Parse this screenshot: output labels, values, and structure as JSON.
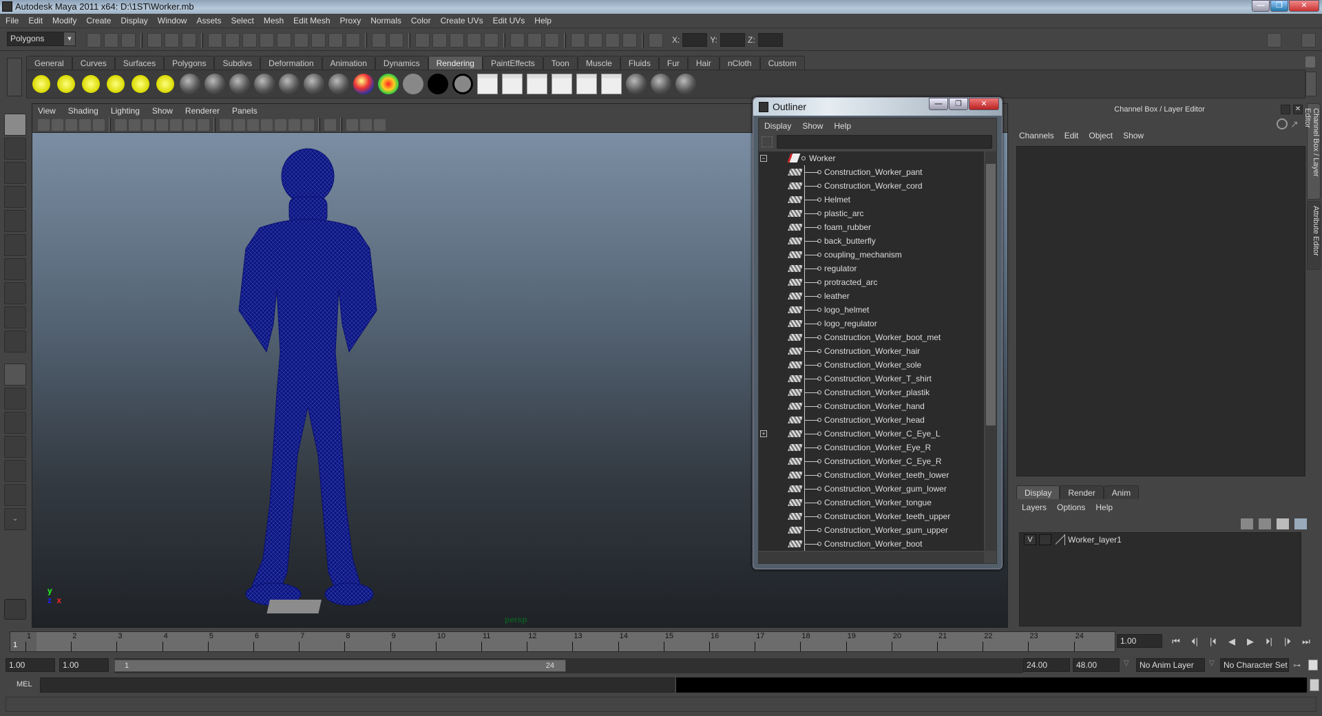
{
  "window": {
    "title": "Autodesk Maya 2011 x64: D:\\1ST\\Worker.mb",
    "minimize": "—",
    "maximize": "❐",
    "close": "✕"
  },
  "menubar": [
    "File",
    "Edit",
    "Modify",
    "Create",
    "Display",
    "Window",
    "Assets",
    "Select",
    "Mesh",
    "Edit Mesh",
    "Proxy",
    "Normals",
    "Color",
    "Create UVs",
    "Edit UVs",
    "Help"
  ],
  "statusline": {
    "mode": "Polygons",
    "x_label": "X:",
    "y_label": "Y:",
    "z_label": "Z:",
    "x_value": "",
    "y_value": "",
    "z_value": ""
  },
  "shelf": {
    "tabs": [
      "General",
      "Curves",
      "Surfaces",
      "Polygons",
      "Subdivs",
      "Deformation",
      "Animation",
      "Dynamics",
      "Rendering",
      "PaintEffects",
      "Toon",
      "Muscle",
      "Fluids",
      "Fur",
      "Hair",
      "nCloth",
      "Custom"
    ],
    "active_tab": "Rendering",
    "icons": [
      "ambient-light-icon",
      "directional-light-icon",
      "point-light-icon",
      "spot-light-icon",
      "area-light-icon",
      "volume-light-icon",
      "camera-icon",
      "hypershade-icon",
      "anisotropic-shader-icon",
      "blinn-shader-icon",
      "lambert-shader-icon",
      "phong-shader-icon",
      "phonge-shader-icon",
      "ramp-shader-icon",
      "rampcolor-icon",
      "surface-shader-icon",
      "use-background-icon",
      "layered-shader-icon",
      "render-view-icon",
      "render-current-icon",
      "ipr-render-icon",
      "batch-render-icon",
      "render-settings-icon",
      "light-linking-icon",
      "break-link-icon",
      "shader-ball-icon",
      "paint-brush-icon"
    ]
  },
  "viewport": {
    "menu": [
      "View",
      "Shading",
      "Lighting",
      "Show",
      "Renderer",
      "Panels"
    ],
    "camera": "persp",
    "axis": {
      "y": "y",
      "z": "z",
      "x": "x"
    }
  },
  "outliner": {
    "title": "Outliner",
    "menu": [
      "Display",
      "Show",
      "Help"
    ],
    "filter_value": "",
    "root": "Worker",
    "items": [
      "Construction_Worker_pant",
      "Construction_Worker_cord",
      "Helmet",
      "plastic_arc",
      "foam_rubber",
      "back_butterfly",
      "coupling_mechanism",
      "regulator",
      "protracted_arc",
      "leather",
      "logo_helmet",
      "logo_regulator",
      "Construction_Worker_boot_met",
      "Construction_Worker_hair",
      "Construction_Worker_sole",
      "Construction_Worker_T_shirt",
      "Construction_Worker_plastik",
      "Construction_Worker_hand",
      "Construction_Worker_head",
      "Construction_Worker_C_Eye_L",
      "Construction_Worker_Eye_R",
      "Construction_Worker_C_Eye_R",
      "Construction_Worker_teeth_lower",
      "Construction_Worker_gum_lower",
      "Construction_Worker_tongue",
      "Construction_Worker_teeth_upper",
      "Construction_Worker_gum_upper",
      "Construction_Worker_boot"
    ],
    "expandable_index": 19,
    "expand_collapse": "−",
    "expand_plus": "+"
  },
  "channelbox": {
    "title": "Channel Box / Layer Editor",
    "menu": [
      "Channels",
      "Edit",
      "Object",
      "Show"
    ],
    "layer_tabs": [
      "Display",
      "Render",
      "Anim"
    ],
    "active_layer_tab": "Display",
    "layer_menu": [
      "Layers",
      "Options",
      "Help"
    ],
    "layers": [
      {
        "visible": "V",
        "name": "Worker_layer1"
      }
    ],
    "side_tabs": [
      "Channel Box / Layer Editor",
      "Attribute Editor"
    ]
  },
  "timeline": {
    "ticks": [
      "1",
      "2",
      "3",
      "4",
      "5",
      "6",
      "7",
      "8",
      "9",
      "10",
      "11",
      "12",
      "13",
      "14",
      "15",
      "16",
      "17",
      "18",
      "19",
      "20",
      "21",
      "22",
      "23",
      "24"
    ],
    "current_frame_marker": "1",
    "current_frame": "1.00"
  },
  "range": {
    "anim_start": "1.00",
    "playback_start": "1.00",
    "slider_start": "1",
    "slider_end": "24",
    "playback_end": "24.00",
    "anim_end": "48.00",
    "anim_layer": "No Anim Layer",
    "character_set": "No Character Set"
  },
  "playback": [
    "go-to-start",
    "step-back-key",
    "step-back-frame",
    "play-backwards",
    "play-forwards",
    "step-forward-frame",
    "step-forward-key",
    "go-to-end"
  ],
  "playback_glyphs": [
    "⏮",
    "⏴|",
    "|⏴",
    "◀",
    "▶",
    "⏵|",
    "|⏵",
    "⏭"
  ],
  "cmdline": {
    "label": "MEL",
    "value": "",
    "result": ""
  },
  "helpline": {
    "text": ""
  },
  "colors": {
    "wireframe": "#0b1480",
    "accent_close": "#c33",
    "viewport_top": "#7b8ea3",
    "viewport_bottom": "#1f2226"
  }
}
